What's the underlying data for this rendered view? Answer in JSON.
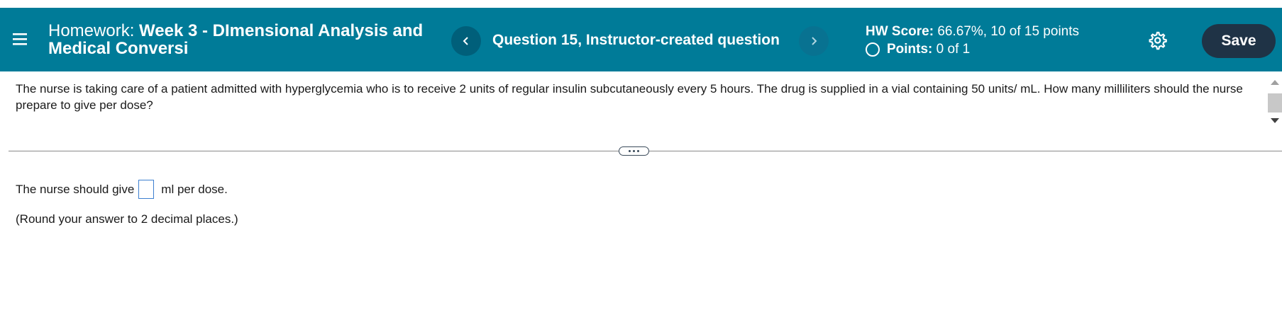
{
  "header": {
    "title_prefix": "Homework:",
    "title_bold": "Week 3 - DImensional Analysis and Medical Conversi",
    "question_title": "Question 15, Instructor-created question",
    "prev_icon": "chevron-left-icon",
    "next_icon": "chevron-right-icon",
    "score_label": "HW Score:",
    "score_value": "66.67%, 10 of 15 points",
    "points_label": "Points:",
    "points_value": "0 of 1",
    "save_label": "Save",
    "colors": {
      "bar": "#007b98",
      "save": "#1f3346"
    }
  },
  "question": {
    "text": "The nurse is taking care of a patient admitted with hyperglycemia who is to receive 2 units of regular insulin subcutaneously every 5 hours. The drug is supplied in a vial containing 50 units/ mL. How many milliliters should the nurse prepare to give per dose?"
  },
  "answer": {
    "before": "The nurse should give",
    "after": "ml per dose.",
    "value": "",
    "note": "(Round your answer to 2 decimal places.)"
  }
}
